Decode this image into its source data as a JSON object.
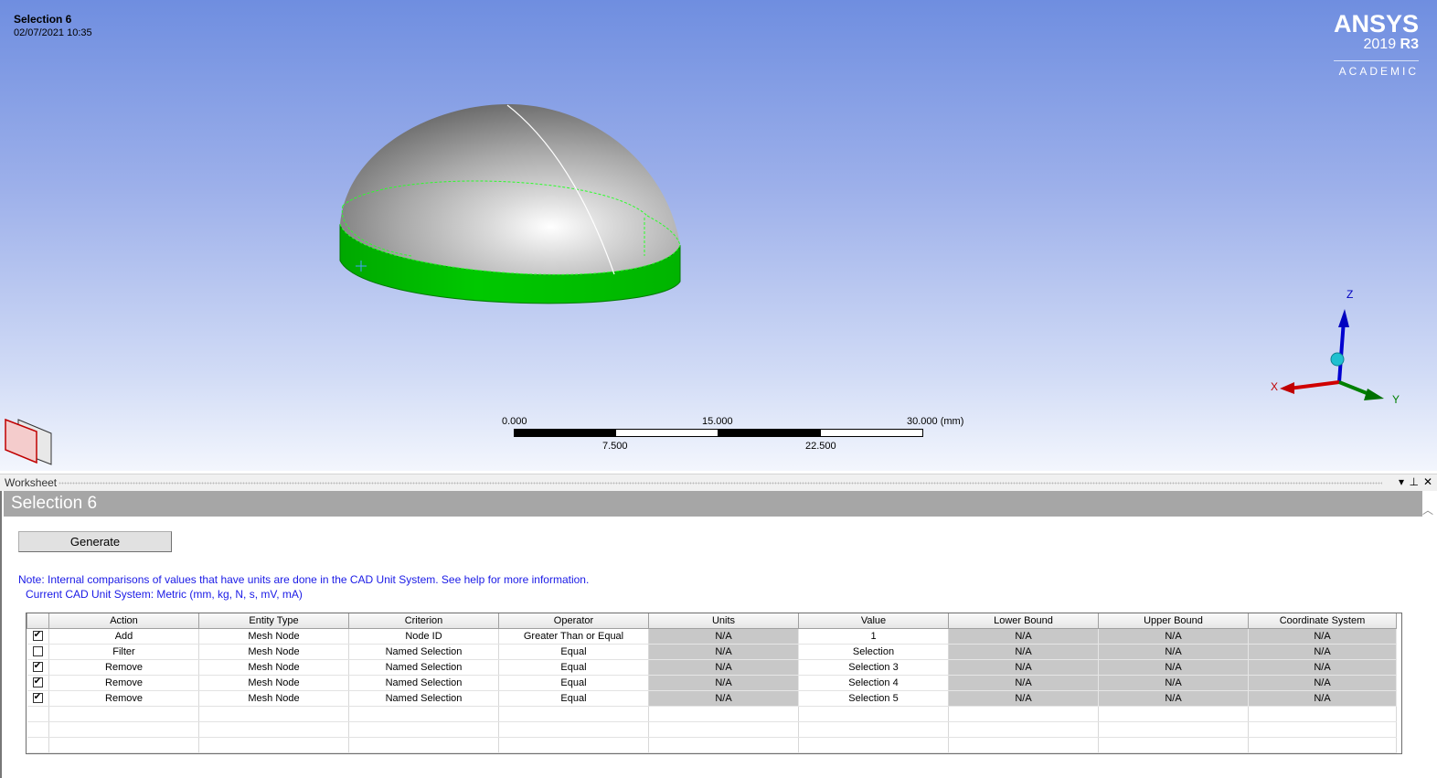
{
  "viewport": {
    "title": "Selection 6",
    "timestamp": "02/07/2021 10:35",
    "logo": {
      "brand": "ANSYS",
      "version": "2019",
      "release": "R3",
      "edition": "ACADEMIC"
    },
    "scale": {
      "top_labels": [
        "0.000",
        "15.000",
        "30.000 (mm)"
      ],
      "bottom_labels": [
        "7.500",
        "22.500"
      ]
    },
    "triad": {
      "x": "X",
      "y": "Y",
      "z": "Z"
    },
    "colors": {
      "selected_face": "#00c000",
      "background_top": "#6f8ee0",
      "background_bottom": "#f3f6fd"
    }
  },
  "worksheet": {
    "panel_label": "Worksheet",
    "title": "Selection 6",
    "generate_label": "Generate",
    "note": "Note: Internal comparisons of values that have units are done in the CAD Unit System. See help for more information.",
    "unit_system": "Current CAD Unit System:  Metric (mm, kg, N, s, mV, mA)",
    "columns": [
      "Action",
      "Entity Type",
      "Criterion",
      "Operator",
      "Units",
      "Value",
      "Lower Bound",
      "Upper Bound",
      "Coordinate System"
    ],
    "rows": [
      {
        "checked": true,
        "cells": [
          "Add",
          "Mesh Node",
          "Node ID",
          "Greater Than or Equal",
          "N/A",
          "1",
          "N/A",
          "N/A",
          "N/A"
        ]
      },
      {
        "checked": false,
        "cells": [
          "Filter",
          "Mesh Node",
          "Named Selection",
          "Equal",
          "N/A",
          "Selection",
          "N/A",
          "N/A",
          "N/A"
        ]
      },
      {
        "checked": true,
        "cells": [
          "Remove",
          "Mesh Node",
          "Named Selection",
          "Equal",
          "N/A",
          "Selection 3",
          "N/A",
          "N/A",
          "N/A"
        ]
      },
      {
        "checked": true,
        "cells": [
          "Remove",
          "Mesh Node",
          "Named Selection",
          "Equal",
          "N/A",
          "Selection 4",
          "N/A",
          "N/A",
          "N/A"
        ]
      },
      {
        "checked": true,
        "cells": [
          "Remove",
          "Mesh Node",
          "Named Selection",
          "Equal",
          "N/A",
          "Selection 5",
          "N/A",
          "N/A",
          "N/A"
        ]
      }
    ],
    "empty_rows": 3
  }
}
